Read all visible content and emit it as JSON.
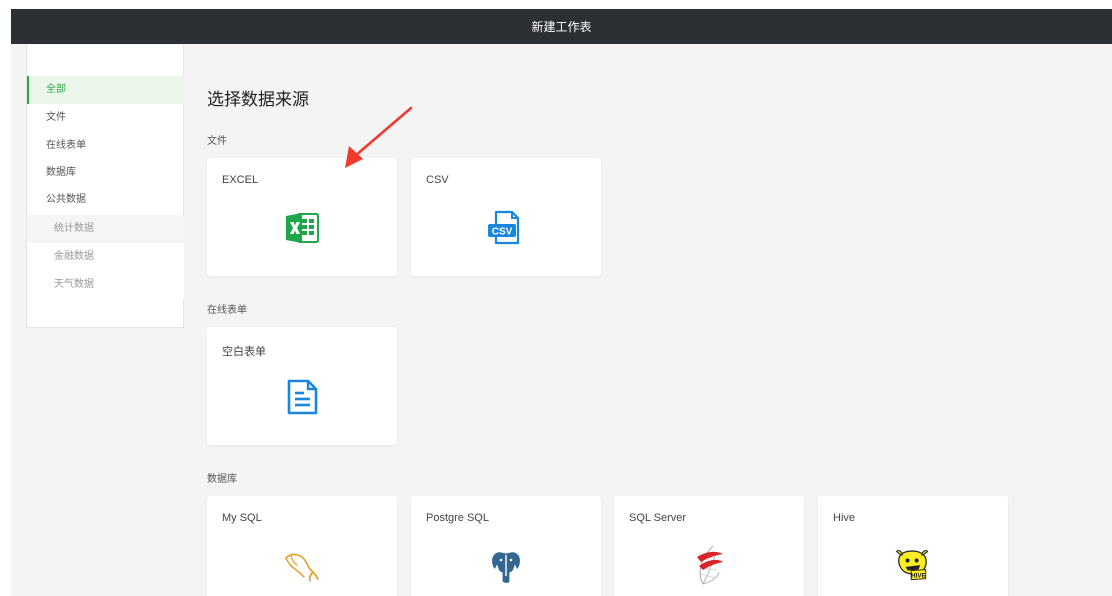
{
  "header": {
    "title": "新建工作表"
  },
  "sidebar": {
    "items": [
      {
        "label": "全部"
      },
      {
        "label": "文件"
      },
      {
        "label": "在线表单"
      },
      {
        "label": "数据库"
      },
      {
        "label": "公共数据"
      },
      {
        "label": "统计数据"
      },
      {
        "label": "金融数据"
      },
      {
        "label": "天气数据"
      }
    ]
  },
  "main": {
    "title": "选择数据来源",
    "sections": [
      {
        "label": "文件",
        "cards": [
          {
            "label": "EXCEL",
            "icon": "excel-icon"
          },
          {
            "label": "CSV",
            "icon": "csv-icon"
          }
        ]
      },
      {
        "label": "在线表单",
        "cards": [
          {
            "label": "空白表单",
            "icon": "blank-form-icon"
          }
        ]
      },
      {
        "label": "数据库",
        "cards": [
          {
            "label": "My SQL",
            "icon": "mysql-icon"
          },
          {
            "label": "Postgre SQL",
            "icon": "postgresql-icon"
          },
          {
            "label": "SQL Server",
            "icon": "sql-server-icon"
          },
          {
            "label": "Hive",
            "icon": "hive-icon"
          }
        ]
      }
    ],
    "csv_badge": "CSV",
    "hive_badge": "HIVE"
  },
  "colors": {
    "accent": "#2fa84a",
    "topbar": "#2c3034",
    "annotation": "#f03a2e",
    "excel": "#1fa64a",
    "icon_blue": "#1787e0",
    "mysql": "#e69a1f"
  }
}
